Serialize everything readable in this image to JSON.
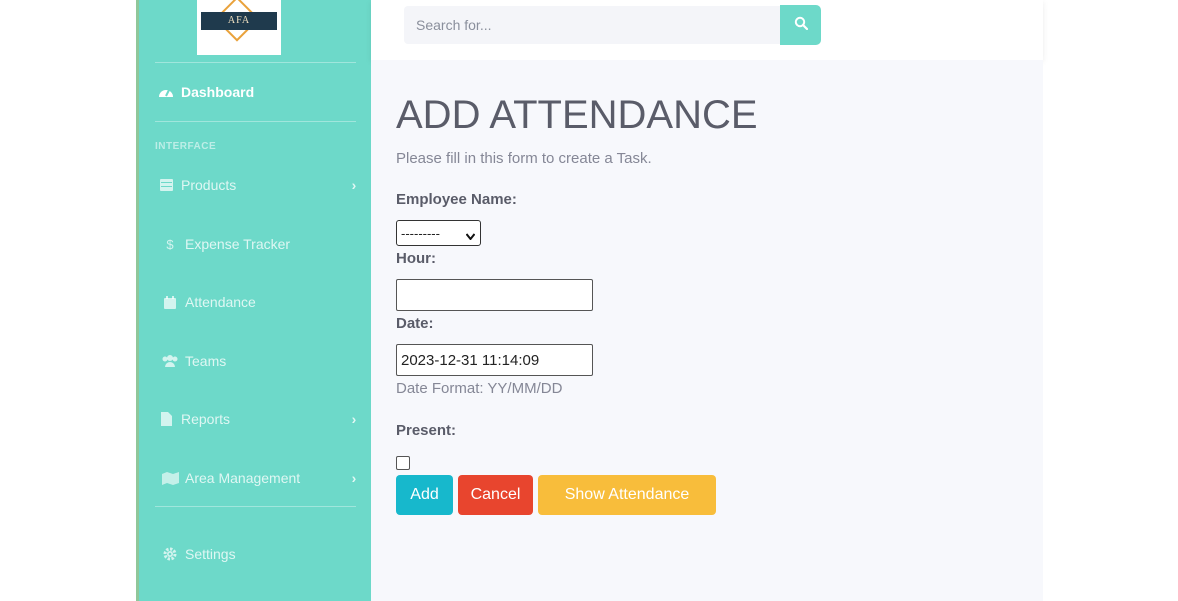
{
  "sidebar": {
    "logo_text": "AFA",
    "dashboard": {
      "label": "Dashboard",
      "icon": "tachometer-icon"
    },
    "section_heading": "INTERFACE",
    "items": [
      {
        "label": "Products",
        "icon": "table-icon",
        "has_submenu": true
      },
      {
        "label": "Expense Tracker",
        "icon": "dollar-icon",
        "has_submenu": false
      },
      {
        "label": "Attendance",
        "icon": "calendar-icon",
        "has_submenu": false
      },
      {
        "label": "Teams",
        "icon": "users-icon",
        "has_submenu": false
      },
      {
        "label": "Reports",
        "icon": "file-icon",
        "has_submenu": true
      },
      {
        "label": "Area Management",
        "icon": "map-icon",
        "has_submenu": true
      }
    ],
    "settings": {
      "label": "Settings",
      "icon": "gear-icon"
    }
  },
  "topbar": {
    "search_placeholder": "Search for...",
    "search_icon": "search-icon"
  },
  "form": {
    "title": "ADD ATTENDANCE",
    "subtitle": "Please fill in this form to create a Task.",
    "employee_label": "Employee Name:",
    "employee_value": "---------",
    "hour_label": "Hour:",
    "hour_value": "",
    "date_label": "Date:",
    "date_value": "2023-12-31 11:14:09",
    "date_help": "Date Format: YY/MM/DD",
    "present_label": "Present:",
    "present_checked": false,
    "buttons": {
      "add": "Add",
      "cancel": "Cancel",
      "show": "Show Attendance"
    }
  },
  "colors": {
    "sidebar_bg": "#6dd9c9",
    "add_button": "#17b8cc",
    "cancel_button": "#e8452e",
    "show_button": "#f8bd3b"
  }
}
